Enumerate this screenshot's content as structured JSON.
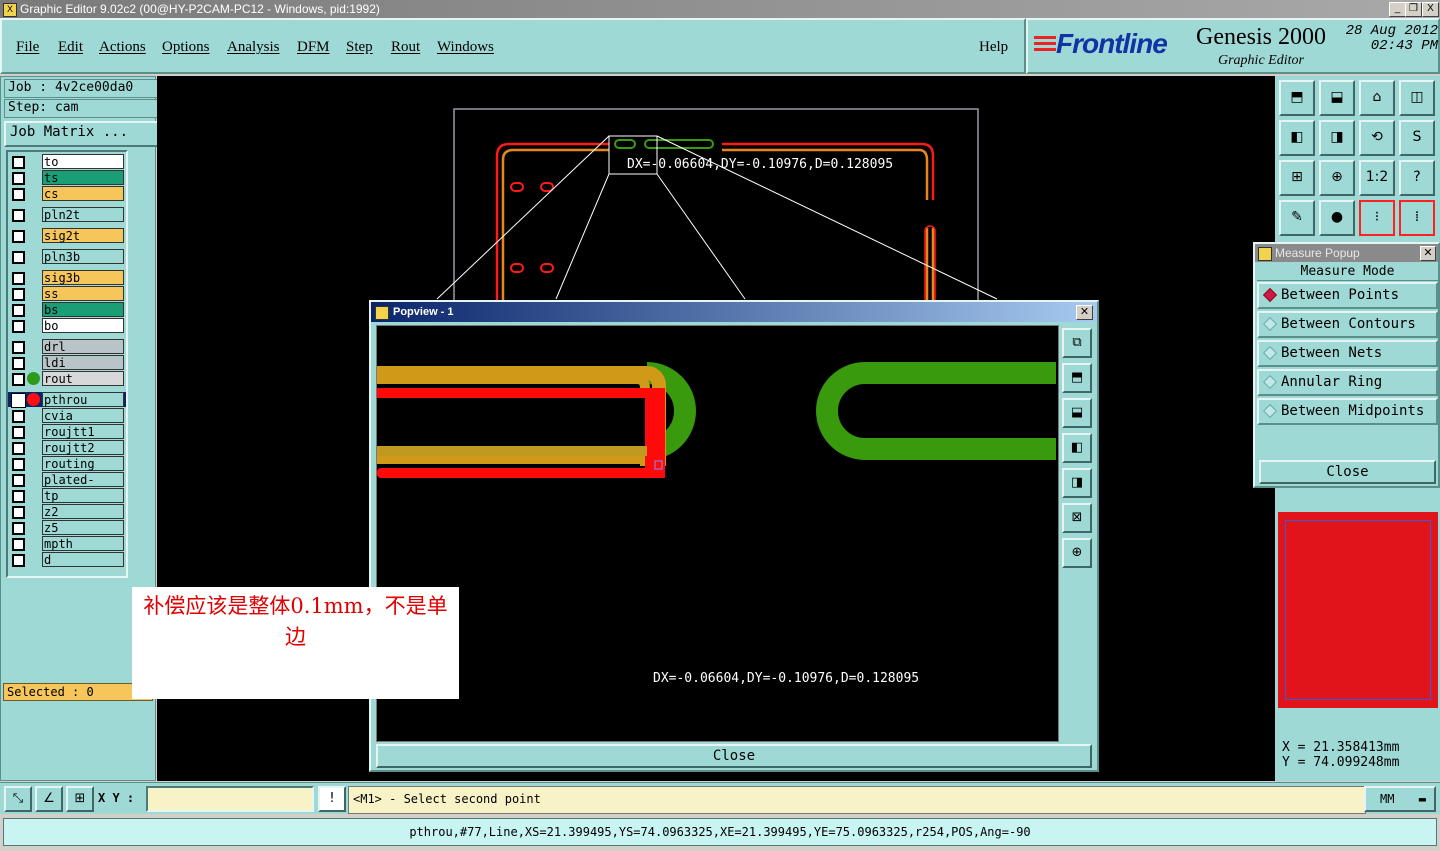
{
  "window": {
    "title": "Graphic Editor 9.02c2 (00@HY-P2CAM-PC12 - Windows, pid:1992)",
    "controls": [
      "_",
      "❐",
      "X"
    ]
  },
  "menu": [
    "File",
    "Edit",
    "Actions",
    "Options",
    "Analysis",
    "DFM",
    "Step",
    "Rout",
    "Windows"
  ],
  "help_label": "Help",
  "brand": {
    "logo": "Frontline",
    "product": "Genesis 2000",
    "subtitle": "Graphic Editor",
    "date": "28 Aug 2012",
    "time": "02:43 PM"
  },
  "job": {
    "job_label": "Job : 4v2ce00da0",
    "step_label": "Step: cam",
    "matrix_button": "Job Matrix ..."
  },
  "layers": [
    {
      "name": "to",
      "color": "#ffffff"
    },
    {
      "name": "ts",
      "color": "#1a9e76"
    },
    {
      "name": "cs",
      "color": "#f6c65b"
    },
    {
      "name": "pln2t",
      "color": "#9fd9d6"
    },
    {
      "name": "sig2t",
      "color": "#f6c65b"
    },
    {
      "name": "pln3b",
      "color": "#9fd9d6"
    },
    {
      "name": "sig3b",
      "color": "#f6c65b"
    },
    {
      "name": "ss",
      "color": "#f6c65b"
    },
    {
      "name": "bs",
      "color": "#1a9e76"
    },
    {
      "name": "bo",
      "color": "#ffffff"
    },
    {
      "name": "drl",
      "color": "#b8c4c8"
    },
    {
      "name": "ldi",
      "color": "#b8c4c8"
    },
    {
      "name": "rout",
      "color": "#d8d8d8",
      "indicator": "#2e9a1c"
    },
    {
      "name": "pthrou",
      "color": "#9fd9d6",
      "indicator": "#ff1010",
      "selected": true
    },
    {
      "name": "cvia",
      "color": "#9fd9d6"
    },
    {
      "name": "roujtt1",
      "color": "#9fd9d6"
    },
    {
      "name": "roujtt2",
      "color": "#9fd9d6"
    },
    {
      "name": "routing",
      "color": "#9fd9d6"
    },
    {
      "name": "plated-edge",
      "color": "#9fd9d6"
    },
    {
      "name": "tp",
      "color": "#9fd9d6"
    },
    {
      "name": "z2",
      "color": "#9fd9d6"
    },
    {
      "name": "z5",
      "color": "#9fd9d6"
    },
    {
      "name": "mpth",
      "color": "#9fd9d6"
    },
    {
      "name": "d",
      "color": "#9fd9d6"
    }
  ],
  "selected_label": "Selected : 0",
  "canvas": {
    "measure_text": "DX=-0.06604,DY=-0.10976,D=0.128095"
  },
  "popview": {
    "title": "Popview - 1",
    "measure_text": "DX=-0.06604,DY=-0.10976,D=0.128095",
    "close": "Close",
    "tools": [
      "zoom-fit-icon",
      "pan-up-icon",
      "pan-down-icon",
      "pan-left-icon",
      "pan-right-icon",
      "zoom-in-icon",
      "zoom-out-icon"
    ]
  },
  "annotation": "补偿应该是整体0.1mm，不是单边",
  "measure_popup": {
    "title": "Measure Popup",
    "mode_label": "Measure Mode",
    "options": [
      {
        "label": "Between Points",
        "active": true
      },
      {
        "label": "Between Contours",
        "active": false
      },
      {
        "label": "Between Nets",
        "active": false
      },
      {
        "label": "Annular Ring",
        "active": false
      },
      {
        "label": "Between Midpoints",
        "active": false
      }
    ],
    "close": "Close"
  },
  "toolbar": {
    "row4_label": "1:2"
  },
  "coords": {
    "x": "X  =  21.358413mm",
    "y": "Y  =  74.099248mm"
  },
  "command": {
    "xy_label": "X Y :",
    "xy_value": "",
    "alert": "!",
    "prompt": "<M1> - Select second point",
    "units": "MM"
  },
  "status_line": "pthrou,#77,Line,XS=21.399495,YS=74.0963325,XE=21.399495,YE=75.0963325,r254,POS,Ang=-90",
  "colors": {
    "panel": "#9fd9d6",
    "board_green": "#3a9a0e",
    "board_red": "#ff0a0a",
    "board_orange": "#e8861a",
    "board_olive": "#c09a20"
  }
}
